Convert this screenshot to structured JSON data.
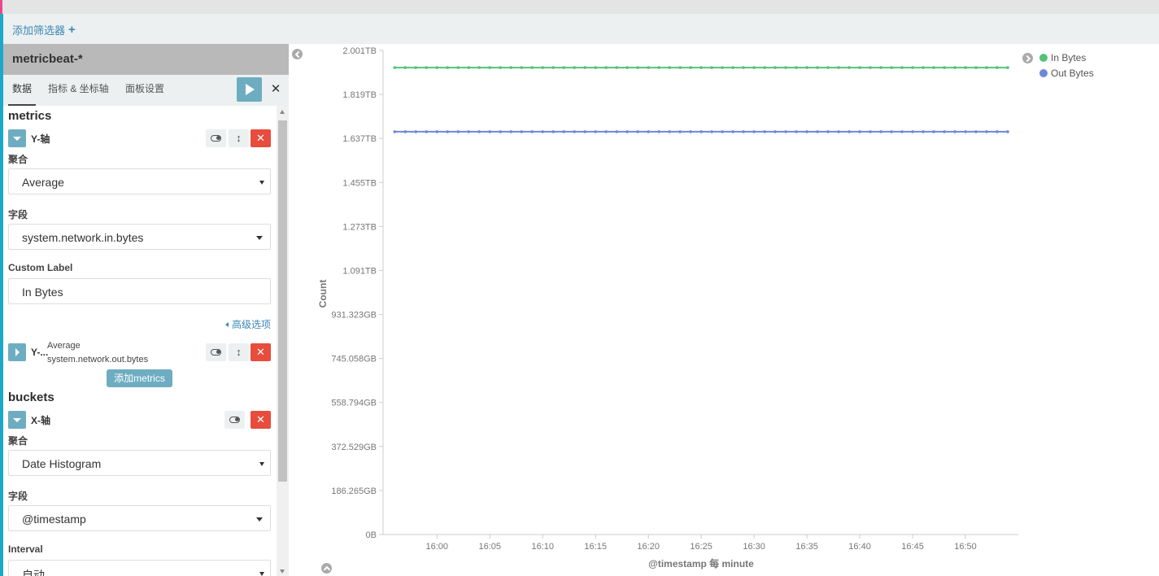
{
  "filter_bar": {
    "add_filter_label": "添加筛选器"
  },
  "sidebar": {
    "index_pattern": "metricbeat-*",
    "tabs": [
      {
        "label": "数据",
        "active": true
      },
      {
        "label": "指标 & 坐标轴",
        "active": false
      },
      {
        "label": "面板设置",
        "active": false
      }
    ],
    "metrics": {
      "title": "metrics",
      "y_axis_1": {
        "label": "Y-轴",
        "aggregation_label": "聚合",
        "aggregation_value": "Average",
        "field_label": "字段",
        "field_value": "system.network.in.bytes",
        "custom_label_label": "Custom Label",
        "custom_label_value": "In Bytes",
        "advanced_link": "高级选项"
      },
      "y_axis_2": {
        "label": "Y-...",
        "summary_agg": "Average",
        "summary_field": "system.network.out.bytes"
      },
      "add_button": "添加metrics"
    },
    "buckets": {
      "title": "buckets",
      "x_axis": {
        "label": "X-轴",
        "aggregation_label": "聚合",
        "aggregation_value": "Date Histogram",
        "field_label": "字段",
        "field_value": "@timestamp",
        "interval_label": "Interval",
        "interval_value": "自动"
      }
    }
  },
  "colors": {
    "in_bytes": "#57c17b",
    "out_bytes": "#6f87d8",
    "accent": "#6eadc1",
    "danger": "#e74c3c"
  },
  "chart_data": {
    "type": "line",
    "xlabel": "@timestamp 每 minute",
    "ylabel": "Count",
    "x_ticks": [
      "16:00",
      "16:05",
      "16:10",
      "16:15",
      "16:20",
      "16:25",
      "16:30",
      "16:35",
      "16:40",
      "16:45",
      "16:50"
    ],
    "y_ticks": [
      "0B",
      "186.265GB",
      "372.529GB",
      "558.794GB",
      "745.058GB",
      "931.323GB",
      "1.091TB",
      "1.273TB",
      "1.455TB",
      "1.637TB",
      "1.819TB",
      "2.001TB"
    ],
    "ylim_tb": [
      0,
      2.001
    ],
    "x_range_minutes": [
      -5.1,
      55
    ],
    "x_minute_offsets": [
      -4,
      -3,
      -2,
      -1,
      0,
      1,
      2,
      3,
      4,
      5,
      6,
      7,
      8,
      9,
      10,
      11,
      12,
      13,
      14,
      15,
      16,
      17,
      18,
      19,
      20,
      21,
      22,
      23,
      24,
      25,
      26,
      27,
      28,
      29,
      30,
      31,
      32,
      33,
      34,
      35,
      36,
      37,
      38,
      39,
      40,
      41,
      42,
      43,
      44,
      45,
      46,
      47,
      48,
      49,
      50,
      51,
      52,
      53,
      54
    ],
    "series": [
      {
        "name": "In Bytes",
        "color": "#57c17b",
        "value_tb": 1.93
      },
      {
        "name": "Out Bytes",
        "color": "#6f87d8",
        "value_tb": 1.665
      }
    ],
    "legend_position": "top-right",
    "grid": false
  }
}
